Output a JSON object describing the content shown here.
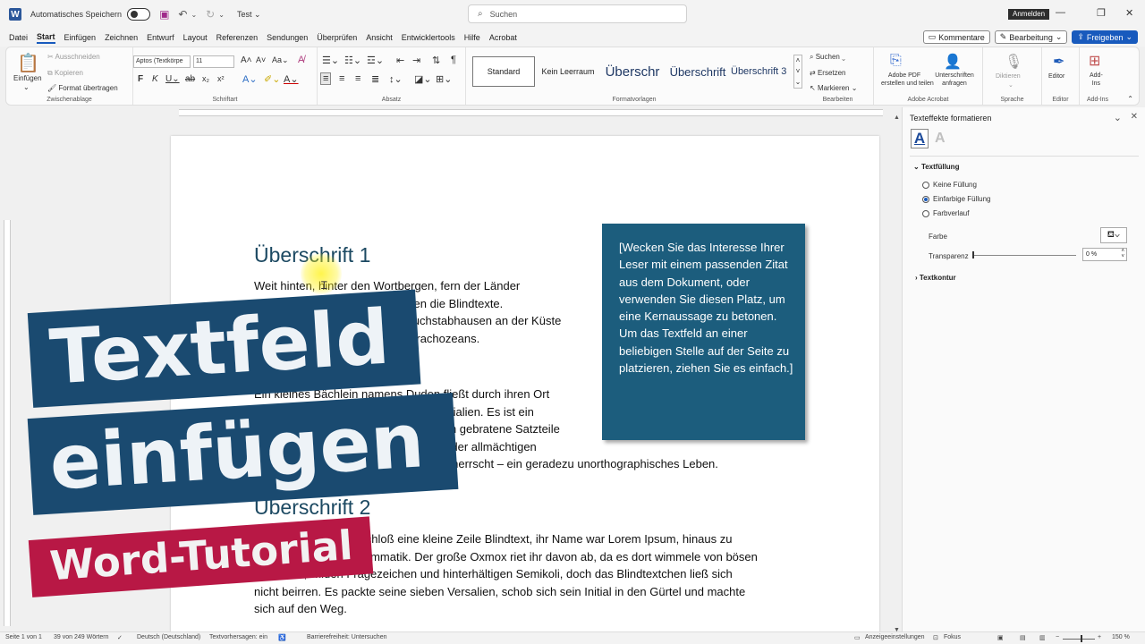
{
  "titlebar": {
    "app_icon": "W",
    "autosave_label": "Automatisches Speichern",
    "doc_title": "Test",
    "search_placeholder": "Suchen",
    "login_label": "Anmelden"
  },
  "menu": {
    "items": [
      "Datei",
      "Start",
      "Einfügen",
      "Zeichnen",
      "Entwurf",
      "Layout",
      "Referenzen",
      "Sendungen",
      "Überprüfen",
      "Ansicht",
      "Entwicklertools",
      "Hilfe",
      "Acrobat"
    ],
    "active": "Start"
  },
  "ribbon_right": {
    "comments": "Kommentare",
    "editing": "Bearbeitung",
    "share": "Freigeben"
  },
  "ribbon": {
    "clipboard": {
      "paste": "Einfügen",
      "cut": "Ausschneiden",
      "copy": "Kopieren",
      "format_painter": "Format übertragen",
      "label": "Zwischenablage"
    },
    "font": {
      "font_name": "Aptos (Textkörpe",
      "font_size": "11",
      "label": "Schriftart"
    },
    "paragraph": {
      "label": "Absatz"
    },
    "styles": {
      "items": [
        "Standard",
        "Kein Leerraum",
        "Überschr",
        "Überschrift",
        "Überschrift 3"
      ],
      "label": "Formatvorlagen"
    },
    "editing": {
      "find": "Suchen",
      "replace": "Ersetzen",
      "select": "Markieren",
      "label": "Bearbeiten"
    },
    "acrobat": {
      "create_pdf_1": "Adobe PDF",
      "create_pdf_2": "erstellen und teilen",
      "sign_1": "Unterschriften",
      "sign_2": "anfragen",
      "label": "Adobe Acrobat"
    },
    "voice": {
      "dictate": "Diktieren",
      "label": "Sprache"
    },
    "editor": {
      "editor": "Editor",
      "label": "Editor"
    },
    "addins": {
      "addins_1": "Add-",
      "addins_2": "Ins",
      "label": "Add-Ins"
    }
  },
  "document": {
    "heading1": "Überschrift 1",
    "para1": "Weit hinten, hinter den Wortbergen, fern der Länder\nVokalien und Konsonantien leben die Blindtexte.\nAbgeschieden wohnen sie in Buchstabhausen an der Küste\ndes Semantik, eines großen Sprachozeans.",
    "para2": "Ein kleines Bächlein namens Duden fließt durch ihren Ort\nund versorgt sie mit den nötigen Regelialien. Es ist ein\nparadiesmatisches Land, in dem einem gebratene Satzteile\nin den Mund fliegen. Nicht einmal von der allmächtigen\nInterpunktion werden die Blindtexte beherrscht – ein geradezu unorthographisches Leben.",
    "heading2": "Überschrift 2",
    "para3": "Eines Tages aber beschloß eine kleine Zeile Blindtext, ihr Name war Lorem Ipsum, hinaus zu\ngehen in die weite Grammatik. Der große Oxmox riet ihr davon ab, da es dort wimmele von bösen\nKommata, wilden Fragezeichen und hinterhältigen Semikoli, doch das Blindtextchen ließ sich\nnicht beirren. Es packte seine sieben Versalien, schob sich sein Initial in den Gürtel und machte\nsich auf den Weg.",
    "textbox": "[Wecken Sie das Interesse Ihrer Leser mit einem passenden Zitat aus dem Dokument, oder verwenden Sie diesen Platz, um eine Kernaussage zu betonen. Um das Textfeld an einer beliebigen Stelle auf der Seite zu platzieren, ziehen Sie es einfach.]"
  },
  "overlay": {
    "line1": "Textfeld",
    "line2": "einfügen",
    "line3": "Word-Tutorial",
    "colors": {
      "dark_blue": "#1a4a70",
      "red": "#b81845"
    }
  },
  "pane": {
    "title": "Texteffekte formatieren",
    "tab_fill_icon": "A",
    "tab_outline_icon": "A",
    "text_fill": "Textfüllung",
    "no_fill": "Keine Füllung",
    "solid_fill": "Einfarbige Füllung",
    "gradient_fill": "Farbverlauf",
    "color_label": "Farbe",
    "transparency_label": "Transparenz",
    "transparency_value": "0 %",
    "text_outline": "Textkontur",
    "selected_fill": "Einfarbige Füllung"
  },
  "status": {
    "page": "Seite 1 von 1",
    "words": "39 von 249 Wörtern",
    "language": "Deutsch (Deutschland)",
    "predictions": "Textvorhersagen: ein",
    "accessibility": "Barrierefreiheit: Untersuchen",
    "display_settings": "Anzeigeeinstellungen",
    "focus": "Fokus",
    "zoom": "150 %"
  }
}
